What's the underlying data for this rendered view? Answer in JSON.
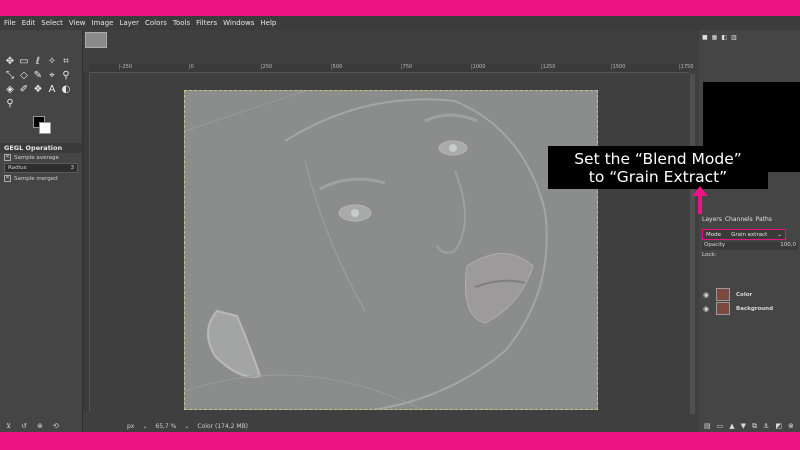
{
  "menu": [
    "File",
    "Edit",
    "Select",
    "View",
    "Image",
    "Layer",
    "Colors",
    "Tools",
    "Filters",
    "Windows",
    "Help"
  ],
  "tool_options": {
    "title": "GEGL Operation",
    "sample_average": "Sample average",
    "radius_label": "Radius",
    "radius_value": "3",
    "sample_merged": "Sample merged"
  },
  "ruler": [
    "|-250",
    "|0",
    "|250",
    "|500",
    "|750",
    "|1000",
    "|1250",
    "|1500",
    "|1750"
  ],
  "status": {
    "unit": "px",
    "zoom": "65,7 %",
    "info": "Color (174,2 MB)"
  },
  "layers_panel": {
    "tabs": [
      "Layers",
      "Channels",
      "Paths"
    ],
    "mode_label": "Mode",
    "mode_value": "Grain extract",
    "opacity_label": "Opacity",
    "opacity_value": "100,0",
    "lock_label": "Lock:",
    "layers": [
      {
        "name": "Color"
      },
      {
        "name": "Background"
      }
    ]
  },
  "callout": {
    "line1": "Set the “Blend Mode”",
    "line2": "to “Grain Extract”"
  },
  "colors": {
    "accent": "#ec1384",
    "callout_bg": "#000000",
    "ui_bg": "#454545"
  }
}
